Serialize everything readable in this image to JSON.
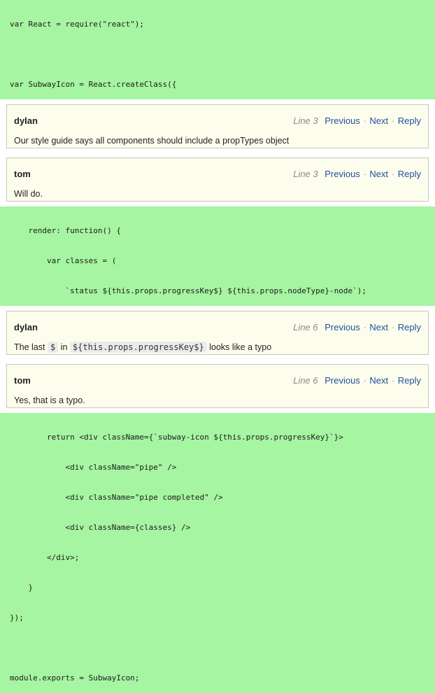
{
  "code_blocks": [
    {
      "lines": [
        "var React = require(\"react\");",
        "",
        "var SubwayIcon = React.createClass({"
      ]
    },
    {
      "lines": [
        "    render: function() {",
        "        var classes = (",
        "            `status ${this.props.progressKey$} ${this.props.nodeType}-node`);"
      ]
    },
    {
      "lines": [
        "        return <div className={`subway-icon ${this.props.progressKey}`}>",
        "            <div className=\"pipe\" />",
        "            <div className=\"pipe completed\" />",
        "            <div className={classes} />",
        "        </div>;",
        "    }",
        "});",
        "",
        "module.exports = SubwayIcon;"
      ]
    }
  ],
  "thread1": [
    {
      "author": "dylan",
      "line": "Line 3",
      "text": "Our style guide says all components should include a propTypes object"
    },
    {
      "author": "tom",
      "line": "Line 3",
      "text": "Will do."
    }
  ],
  "thread2": [
    {
      "author": "dylan",
      "line": "Line 6",
      "text_before": "The last",
      "code1": "$",
      "text_mid": "in",
      "code2": "${this.props.progressKey$}",
      "text_after": "looks like a typo"
    },
    {
      "author": "tom",
      "line": "Line 6",
      "text": "Yes, that is a typo."
    }
  ],
  "nav": {
    "previous": "Previous",
    "next": "Next",
    "reply": "Reply",
    "separator": "·"
  }
}
